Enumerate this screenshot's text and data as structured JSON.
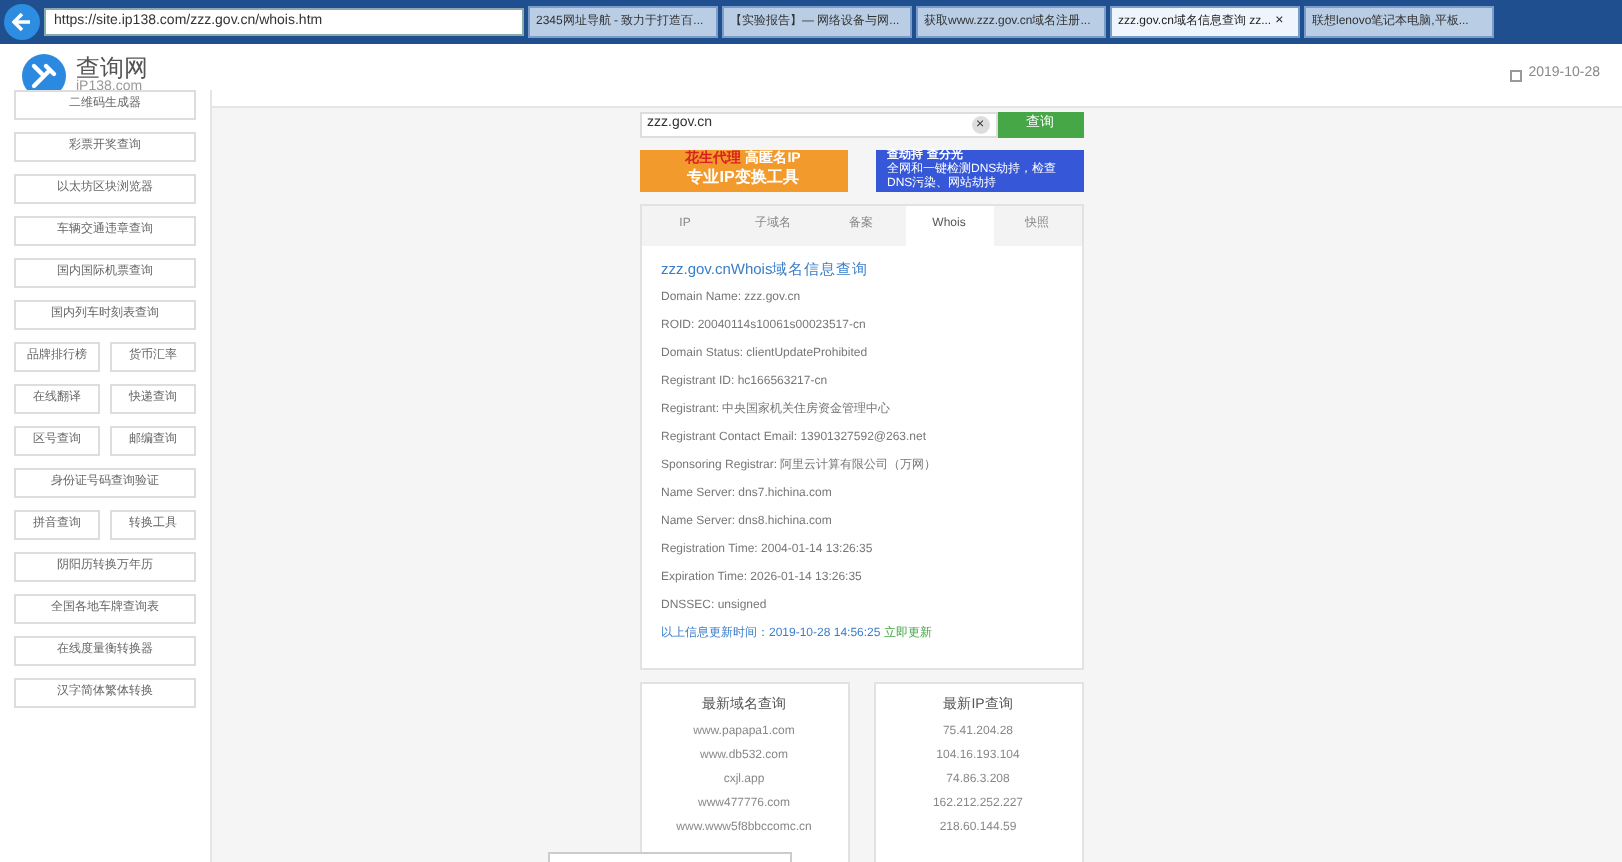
{
  "browser": {
    "address": "https://site.ip138.com/zzz.gov.cn/whois.htm",
    "tabs": [
      {
        "label": "2345网址导航 - 致力于打造百...",
        "selected": false
      },
      {
        "label": "【实验报告】— 网络设备与网...",
        "selected": false
      },
      {
        "label": "获取www.zzz.gov.cn域名注册...",
        "selected": false
      },
      {
        "label": "zzz.gov.cn域名信息查询 zz...",
        "selected": true,
        "close": "×"
      },
      {
        "label": "联想lenovo笔记本电脑,平板...",
        "selected": false
      }
    ]
  },
  "header": {
    "logo_title": "查询网",
    "logo_subtitle": "iP138.com",
    "date": "2019-10-28"
  },
  "sidebar": {
    "items": [
      {
        "label": "二维码生成器",
        "kind": "wide"
      },
      {
        "label": "彩票开奖查询",
        "kind": "wide"
      },
      {
        "label": "以太坊区块浏览器",
        "kind": "wide"
      },
      {
        "label": "车辆交通违章查询",
        "kind": "wide"
      },
      {
        "label": "国内国际机票查询",
        "kind": "wide"
      },
      {
        "label": "国内列车时刻表查询",
        "kind": "wide"
      },
      {
        "label": "品牌排行榜",
        "kind": "half"
      },
      {
        "label": "货币汇率",
        "kind": "half"
      },
      {
        "label": "在线翻译",
        "kind": "half"
      },
      {
        "label": "快递查询",
        "kind": "half"
      },
      {
        "label": "区号查询",
        "kind": "half"
      },
      {
        "label": "邮编查询",
        "kind": "half"
      },
      {
        "label": "身份证号码查询验证",
        "kind": "wide"
      },
      {
        "label": "拼音查询",
        "kind": "half"
      },
      {
        "label": "转换工具",
        "kind": "half"
      },
      {
        "label": "阴阳历转换万年历",
        "kind": "wide"
      },
      {
        "label": "全国各地车牌查询表",
        "kind": "wide"
      },
      {
        "label": "在线度量衡转换器",
        "kind": "wide"
      },
      {
        "label": "汉字简体繁体转换",
        "kind": "wide"
      }
    ]
  },
  "search": {
    "value": "zzz.gov.cn",
    "clear": "×",
    "button": "查询"
  },
  "banners": [
    {
      "line1a": "花生代理",
      "line1b": "高匿名IP",
      "line2": "专业IP变换工具",
      "kind": "orange"
    },
    {
      "line1a": "查劫持",
      "line1b": "查分光",
      "line2": "全网和一键检测DNS劫持，检查DNS污染、网站劫持",
      "kind": "blue"
    }
  ],
  "result_tabs": [
    {
      "label": "IP",
      "selected": false
    },
    {
      "label": "子域名",
      "selected": false
    },
    {
      "label": "备案",
      "selected": false
    },
    {
      "label": "Whois",
      "selected": true
    },
    {
      "label": "快照",
      "selected": false
    }
  ],
  "whois": {
    "title_link": "zzz.gov.cn",
    "title_rest": "Whois域名信息查询",
    "lines": [
      "Domain Name: zzz.gov.cn",
      "ROID: 20040114s10061s00023517-cn",
      "Domain Status: clientUpdateProhibited",
      "Registrant ID: hc166563217-cn",
      "Registrant: 中央国家机关住房资金管理中心",
      "Registrant Contact Email: 13901327592@263.net",
      "Sponsoring Registrar: 阿里云计算有限公司（万网）",
      "Name Server: dns7.hichina.com",
      "Name Server: dns8.hichina.com",
      "Registration Time: 2004-01-14 13:26:35",
      "Expiration Time: 2026-01-14 13:26:35",
      "DNSSEC: unsigned"
    ],
    "updated": "以上信息更新时间：2019-10-28 14:56:25",
    "refresh": "立即更新"
  },
  "latest": [
    {
      "title": "最新域名查询",
      "items": [
        "www.papapa1.com",
        "www.db532.com",
        "cxjl.app",
        "www477776.com",
        "www.www5f8bbccomc.cn"
      ]
    },
    {
      "title": "最新IP查询",
      "items": [
        "75.41.204.28",
        "104.16.193.104",
        "74.86.3.208",
        "162.212.252.227",
        "218.60.144.59"
      ]
    }
  ]
}
